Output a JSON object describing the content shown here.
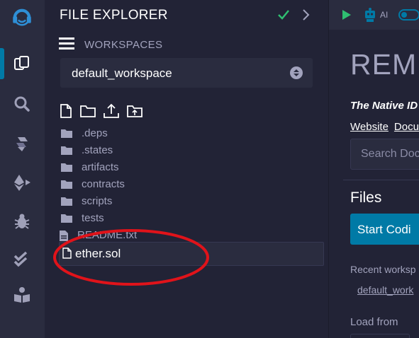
{
  "icon_panel": {
    "items": [
      {
        "icon": "remix-logo-icon"
      },
      {
        "icon": "file-explorer-icon",
        "active": true
      },
      {
        "icon": "search-icon"
      },
      {
        "icon": "solidity-compiler-icon"
      },
      {
        "icon": "deploy-run-icon"
      },
      {
        "icon": "debugger-icon"
      },
      {
        "icon": "unit-testing-icon"
      },
      {
        "icon": "learneth-icon"
      }
    ]
  },
  "file_explorer": {
    "title": "FILE EXPLORER",
    "workspaces_label": "WORKSPACES",
    "workspace_selected": "default_workspace",
    "toolbar_icons": [
      "new-file-icon",
      "new-folder-icon",
      "publish-icon",
      "upload-icon"
    ],
    "tree": [
      {
        "type": "folder",
        "name": ".deps"
      },
      {
        "type": "folder",
        "name": ".states"
      },
      {
        "type": "folder",
        "name": "artifacts"
      },
      {
        "type": "folder",
        "name": "contracts"
      },
      {
        "type": "folder",
        "name": "scripts"
      },
      {
        "type": "folder",
        "name": "tests"
      },
      {
        "type": "file",
        "name": "README.txt"
      }
    ],
    "new_file_input_value": "ether.sol"
  },
  "home": {
    "top_icons": [
      "run-icon",
      "ai-icon",
      "toggle-icon"
    ],
    "ai_label": "AI",
    "title": "REMI",
    "tagline": "The Native ID",
    "links": [
      "Website",
      "Docu"
    ],
    "search_placeholder": "Search Doc",
    "files_heading": "Files",
    "start_button": "Start Codi",
    "recent_workspaces_label": "Recent worksp",
    "recent_workspace_item": "default_work",
    "load_from_label": "Load from"
  },
  "colors": {
    "background": "#222336",
    "panel": "#2a2c3f",
    "accent": "#007aa6",
    "check": "#2fbf71",
    "annotation_ellipse": "#e0131a"
  }
}
